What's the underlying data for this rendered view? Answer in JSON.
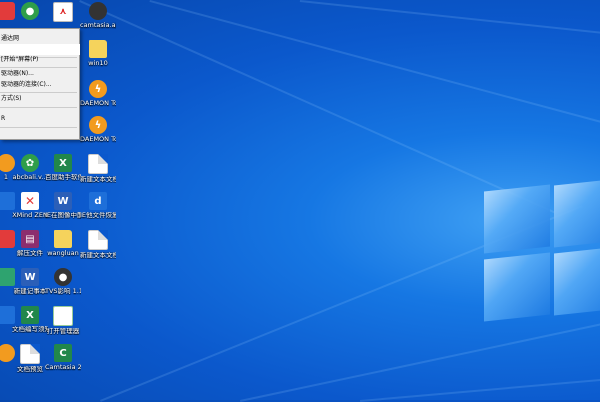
{
  "colors": {
    "desktop": "#0b58cc",
    "menu_bg": "#f0f0f0"
  },
  "context_menu": {
    "items": [
      {
        "label": "通达网"
      },
      {
        "label": ""
      },
      {
        "label": "[开始\"屏幕(P)"
      },
      {
        "label": "驱动器(N)..."
      },
      {
        "label": "驱动器的连接(C)..."
      },
      {
        "label": "方式(S)"
      },
      {
        "label": "R"
      }
    ]
  },
  "desktop_icons": [
    {
      "label": "",
      "icon": "app-icon"
    },
    {
      "label": "",
      "icon": "wechat-icon"
    },
    {
      "label": "",
      "icon": "pdf-icon"
    },
    {
      "label": "camtasia.ap...",
      "icon": "camtasia-icon"
    },
    {
      "label": "win10",
      "icon": "folder-icon"
    },
    {
      "label": "DAEMON Tools Lite",
      "icon": "daemon-tools-icon"
    },
    {
      "label": "DAEMON Tools Lite",
      "icon": "daemon-tools-icon"
    },
    {
      "label": "1",
      "icon": "app-icon"
    },
    {
      "label": "abcbali.v...",
      "icon": "green-app-icon"
    },
    {
      "label": "百度助手软件 问题及解决...",
      "icon": "excel-icon"
    },
    {
      "label": "新建文本文档",
      "icon": "text-file-icon"
    },
    {
      "label": "",
      "icon": "blue-app-icon"
    },
    {
      "label": "XMind ZEN",
      "icon": "xmind-icon"
    },
    {
      "label": "IE在图像中配置...",
      "icon": "word-icon"
    },
    {
      "label": "IE他文件恢复...",
      "icon": "blue-app-icon"
    },
    {
      "label": "",
      "icon": "app-icon"
    },
    {
      "label": "解压文件",
      "icon": "winrar-icon"
    },
    {
      "label": "wangluan",
      "icon": "folder-icon"
    },
    {
      "label": "新建文本文档 (2)",
      "icon": "text-file-icon"
    },
    {
      "label": "",
      "icon": "app-icon"
    },
    {
      "label": "新建记事本",
      "icon": "word-icon"
    },
    {
      "label": "TVS影响 1.13693...",
      "icon": "media-icon"
    },
    {
      "label": "",
      "icon": "app-icon"
    },
    {
      "label": "文档编写须知",
      "icon": "excel-icon"
    },
    {
      "label": "打开管理器",
      "icon": "sheet-icon"
    },
    {
      "label": "",
      "icon": "app-icon"
    },
    {
      "label": "文档预览",
      "icon": "text-file-icon"
    },
    {
      "label": "Camtasia 2019",
      "icon": "camtasia-green-icon"
    }
  ]
}
